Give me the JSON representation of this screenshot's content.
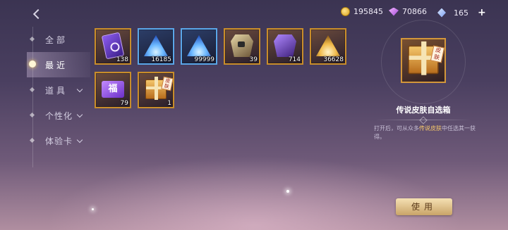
{
  "header": {
    "back_icon": "back-arrow-icon",
    "currencies": [
      {
        "icon": "gold-coin-icon",
        "value": "195845"
      },
      {
        "icon": "purple-gem-icon",
        "value": "70866"
      },
      {
        "icon": "blue-crystal-icon",
        "value": "165"
      }
    ],
    "add_label": "+"
  },
  "nav": {
    "items": [
      {
        "label": "全部",
        "active": false,
        "has_chevron": false
      },
      {
        "label": "最近",
        "active": true,
        "has_chevron": false
      },
      {
        "label": "道具",
        "active": false,
        "has_chevron": true
      },
      {
        "label": "个性化",
        "active": false,
        "has_chevron": true
      },
      {
        "label": "体验卡",
        "active": false,
        "has_chevron": true
      }
    ]
  },
  "items": [
    {
      "icon": "purple-card-icon",
      "count": "138"
    },
    {
      "icon": "blue-shard-icon",
      "count": "16185"
    },
    {
      "icon": "blue-shard-icon",
      "count": "99999"
    },
    {
      "icon": "gold-puzzle-icon",
      "count": "39"
    },
    {
      "icon": "purple-puzzle-icon",
      "count": "714"
    },
    {
      "icon": "gold-shard-icon",
      "count": "36628"
    },
    {
      "icon": "fortune-ticket-icon",
      "count": "79"
    },
    {
      "icon": "skin-gift-box-icon",
      "count": "1",
      "tag": "皮肤"
    }
  ],
  "detail": {
    "icon": "skin-gift-box-icon",
    "tag": "皮肤",
    "title": "传说皮肤自选箱",
    "desc_before": "打开后，可从众多",
    "desc_highlight": "传说皮肤",
    "desc_after": "中任选其一获得。",
    "use_label": "使用"
  },
  "colors": {
    "accent_gold": "#c98d2a",
    "highlight": "#f5c76a",
    "rare_blue": "#5aa6e8"
  }
}
